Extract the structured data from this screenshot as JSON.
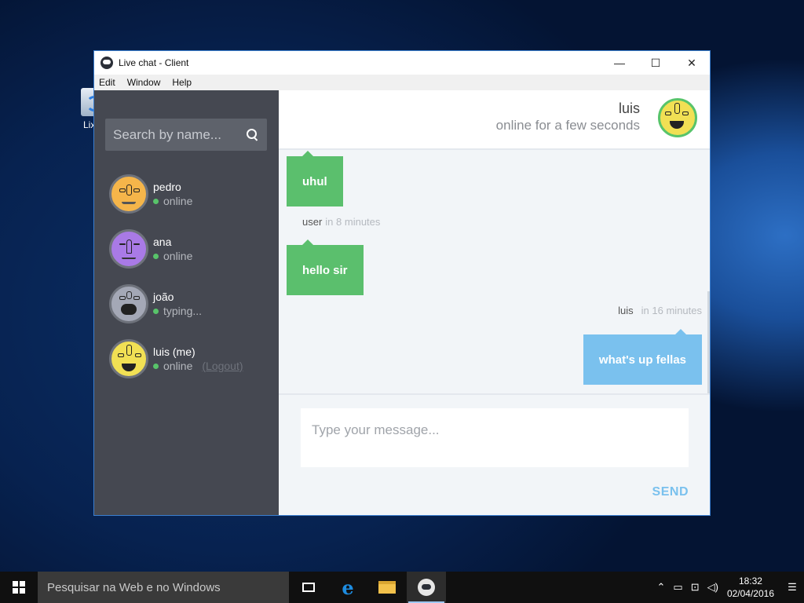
{
  "desktop": {
    "recycle_label": "Lixe"
  },
  "window": {
    "title": "Live chat - Client",
    "controls": {
      "minimize": "—",
      "maximize": "☐",
      "close": "✕"
    }
  },
  "menu": [
    "Edit",
    "Window",
    "Help"
  ],
  "sidebar": {
    "search_placeholder": "Search by name...",
    "contacts": [
      {
        "name": "pedro",
        "status": "online",
        "avatar_color": "#f5b54a"
      },
      {
        "name": "ana",
        "status": "online",
        "avatar_color": "#a97ae6"
      },
      {
        "name": "joão",
        "status": "typing...",
        "avatar_color": "#a4a8b6"
      },
      {
        "name": "luis (me)",
        "status": "online",
        "logout": "(Logout)",
        "avatar_color": "#f1e054"
      }
    ]
  },
  "chat": {
    "header": {
      "name": "luis",
      "status": "online for a few seconds"
    },
    "messages": [
      {
        "text": "uhul",
        "direction": "in"
      },
      {
        "author": "user",
        "time": "in 8 minutes",
        "text": "hello sir",
        "direction": "in"
      },
      {
        "author": "luis",
        "time": "in 16 minutes",
        "text": "what's up fellas",
        "direction": "out"
      }
    ],
    "input_placeholder": "Type your message...",
    "send_label": "SEND"
  },
  "colors": {
    "incoming_bubble": "#5bbf6d",
    "outgoing_bubble": "#7ac1ee",
    "sidebar_bg": "#454851",
    "online_dot": "#58c46a"
  },
  "taskbar": {
    "search_placeholder": "Pesquisar na Web e no Windows",
    "time": "18:32",
    "date": "02/04/2016"
  }
}
